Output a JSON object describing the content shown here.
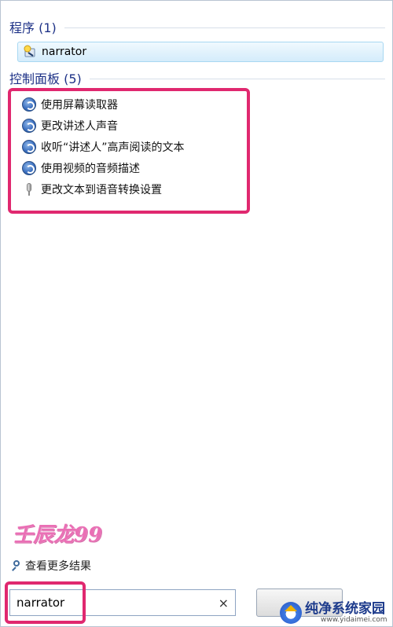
{
  "sections": {
    "programs": {
      "title": "程序 (1)"
    },
    "control_panel": {
      "title": "控制面板 (5)"
    }
  },
  "program_items": [
    {
      "label": "narrator",
      "icon": "narrator-app-icon"
    }
  ],
  "control_panel_items": [
    {
      "label": "使用屏幕读取器",
      "icon": "ease-of-access-icon"
    },
    {
      "label": "更改讲述人声音",
      "icon": "ease-of-access-icon"
    },
    {
      "label": "收听“讲述人”高声阅读的文本",
      "icon": "ease-of-access-icon"
    },
    {
      "label": "使用视频的音频描述",
      "icon": "ease-of-access-icon"
    },
    {
      "label": "更改文本到语音转换设置",
      "icon": "microphone-icon"
    }
  ],
  "watermark_signature": "壬辰龙99",
  "see_more": {
    "label": "查看更多结果"
  },
  "search": {
    "value": "narrator",
    "clear_glyph": "×"
  },
  "site_badge": {
    "name": "纯净系统家园",
    "url": "www.yidaimei.com"
  },
  "colors": {
    "header_text": "#1e3287",
    "highlight": "#e0286f",
    "selection_border": "#a8d8f2"
  }
}
